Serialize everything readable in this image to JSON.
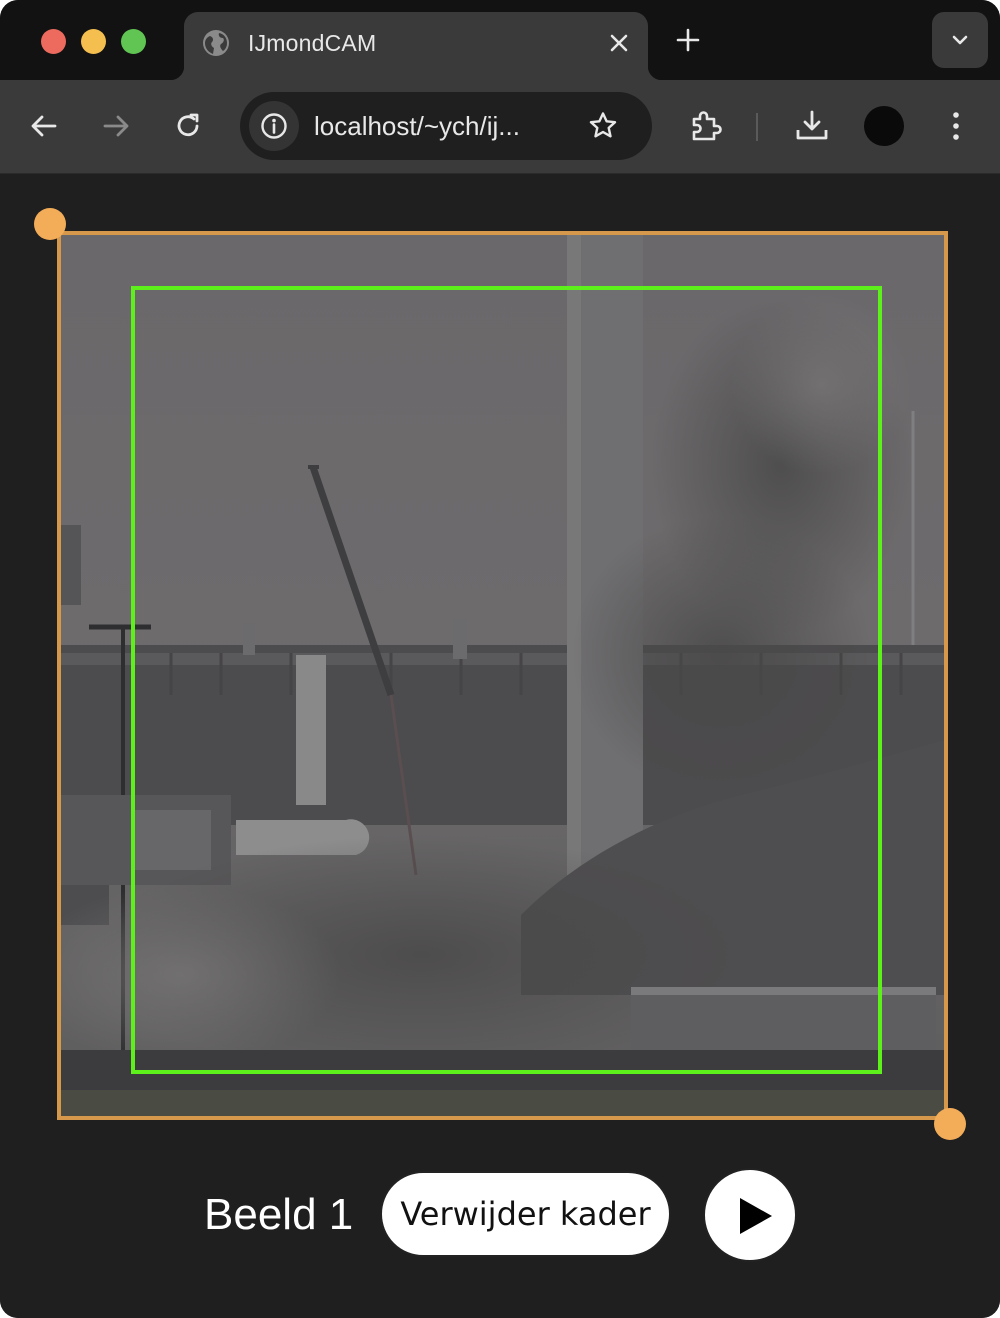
{
  "browser": {
    "tab": {
      "title": "IJmondCAM"
    },
    "address_bar": {
      "url": "localhost/~ych/ij..."
    }
  },
  "icons": {
    "tab_favicon": "globe-icon",
    "tab_close": "close-icon",
    "new_tab": "plus-icon",
    "tab_menu": "chevron-down-icon",
    "back": "arrow-left-icon",
    "forward": "arrow-right-icon",
    "reload": "reload-icon",
    "site_info": "info-icon",
    "bookmark": "star-icon",
    "extensions": "puzzle-icon",
    "downloads": "download-icon",
    "profile": "avatar",
    "menu": "kebab-menu-icon",
    "play": "play-icon"
  },
  "colors": {
    "frame_border": "#d6994c",
    "handle": "#f3ad58",
    "bbox": "#5df01a"
  },
  "viewer": {
    "frame_label": "Beeld 1",
    "remove_button_label": "Verwijder kader"
  }
}
